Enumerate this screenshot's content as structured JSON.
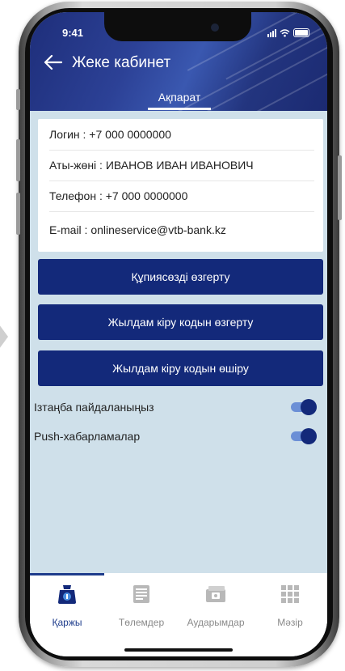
{
  "status_bar": {
    "time": "9:41"
  },
  "header": {
    "title": "Жеке кабинет",
    "tab": "Ақпарат"
  },
  "profile": {
    "login": "Логин : +7 000 0000000",
    "name": "Аты-жөні : ИВАНОВ ИВАН ИВАНОВИЧ",
    "phone": "Телефон : +7 000 0000000",
    "email": "E-mail : onlineservice@vtb-bank.kz"
  },
  "actions": {
    "change_password": "Құпиясөзді өзгерту",
    "change_quick_code": "Жылдам кіру кодын өзгерту",
    "delete_quick_code": "Жылдам кіру кодын өшіру"
  },
  "settings": {
    "use_izanga": {
      "label": "Ізтаңба пайдаланыңыз",
      "enabled": true
    },
    "push": {
      "label": "Push-хабарламалар",
      "enabled": true
    }
  },
  "bottom_nav": {
    "items": [
      {
        "label": "Қаржы",
        "icon": "wallet-icon",
        "active": true
      },
      {
        "label": "Төлемдер",
        "icon": "payments-icon",
        "active": false
      },
      {
        "label": "Аударымдар",
        "icon": "transfers-icon",
        "active": false
      },
      {
        "label": "Мәзір",
        "icon": "menu-grid-icon",
        "active": false
      }
    ]
  },
  "colors": {
    "primary": "#13297a",
    "header": "#2c4196",
    "background": "#cfe0ea",
    "accent": "#1e3c8c"
  }
}
